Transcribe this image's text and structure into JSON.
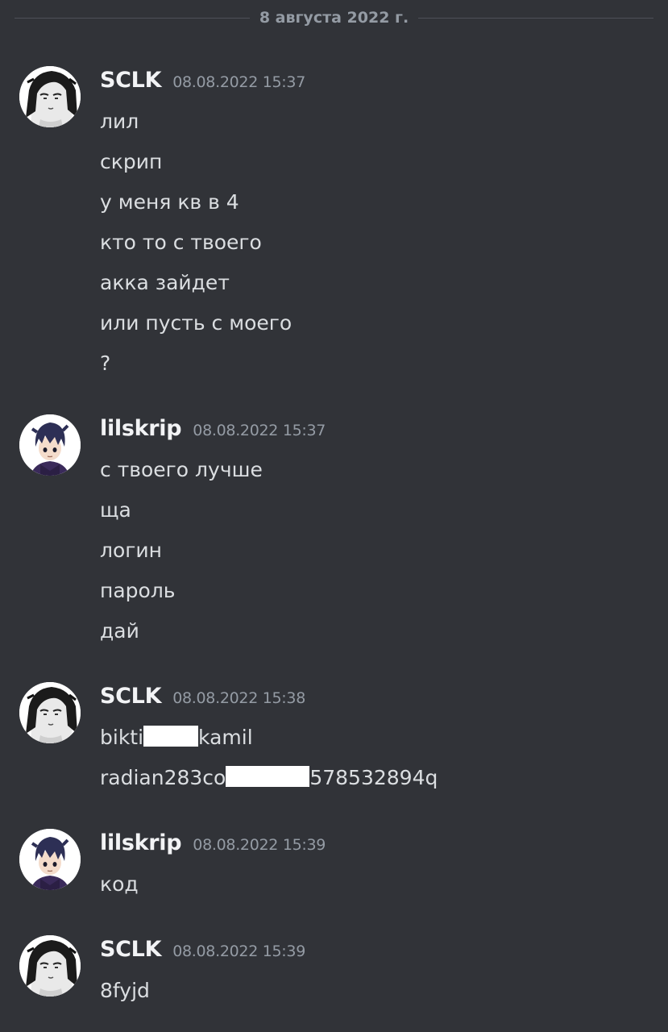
{
  "date_divider": "8 августа 2022 г.",
  "messages": [
    {
      "author": "SCLK",
      "time": "08.08.2022 15:37",
      "lines": [
        "лил",
        "скрип",
        "у меня кв в 4",
        "кто то с твоего",
        "акка зайдет",
        "или пусть с моего",
        "?"
      ]
    },
    {
      "author": "lilskrip",
      "time": "08.08.2022 15:37",
      "lines": [
        "с твоего лучше",
        "ща",
        "логин",
        "пароль",
        "дай"
      ]
    },
    {
      "author": "SCLK",
      "time": "08.08.2022 15:38",
      "line1_pre": "bikti",
      "line1_post": "kamil",
      "line2_pre": "radian283co",
      "line2_post": "578532894q"
    },
    {
      "author": "lilskrip",
      "time": "08.08.2022 15:39",
      "lines": [
        "код"
      ]
    },
    {
      "author": "SCLK",
      "time": "08.08.2022 15:39",
      "lines": [
        "8fyjd"
      ]
    }
  ],
  "colors": {
    "background": "#313338",
    "username": "#f2f3f5",
    "timestamp": "#949ba4",
    "text": "#dbdee1",
    "divider": "#4e5058"
  },
  "icons": {
    "sclk_avatar": "anime-character-manga-avatar",
    "lilskrip_avatar": "anime-character-purple-hair-avatar"
  }
}
